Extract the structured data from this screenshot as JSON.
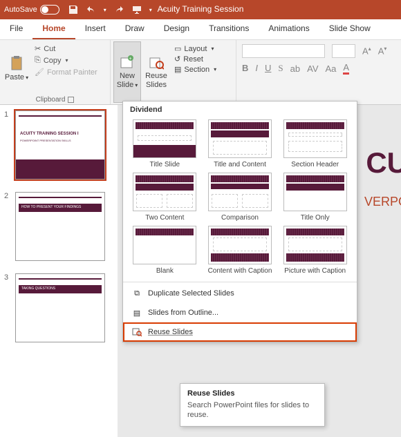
{
  "titlebar": {
    "autosave_label": "AutoSave",
    "autosave_state": "Off",
    "doc_title": "Acuity Training Session"
  },
  "tabs": [
    "File",
    "Home",
    "Insert",
    "Draw",
    "Design",
    "Transitions",
    "Animations",
    "Slide Show"
  ],
  "active_tab_index": 1,
  "ribbon": {
    "clipboard": {
      "paste": "Paste",
      "cut": "Cut",
      "copy": "Copy",
      "format_painter": "Format Painter",
      "group_label": "Clipboard"
    },
    "slides": {
      "new_slide": "New\nSlide",
      "reuse_slides": "Reuse\nSlides",
      "layout": "Layout",
      "reset": "Reset",
      "section": "Section"
    }
  },
  "dropdown": {
    "theme_name": "Dividend",
    "layouts": [
      "Title Slide",
      "Title and Content",
      "Section Header",
      "Two Content",
      "Comparison",
      "Title Only",
      "Blank",
      "Content with Caption",
      "Picture with Caption"
    ],
    "duplicate": "Duplicate Selected Slides",
    "outline": "Slides from Outline...",
    "reuse": "Reuse Slides"
  },
  "tooltip": {
    "title": "Reuse Slides",
    "body": "Search PowerPoint files for slides to reuse."
  },
  "thumbs": [
    {
      "num": "1",
      "title": "ACUITY TRAINING SESSION I",
      "sub": "POWERPOINT PRESENTATION SKILLS"
    },
    {
      "num": "2",
      "title": "HOW TO PRESENT YOUR FINDINGS"
    },
    {
      "num": "3",
      "title": "TAKING QUESTIONS"
    }
  ],
  "slide": {
    "title": "CU",
    "sub": "VERPO"
  }
}
